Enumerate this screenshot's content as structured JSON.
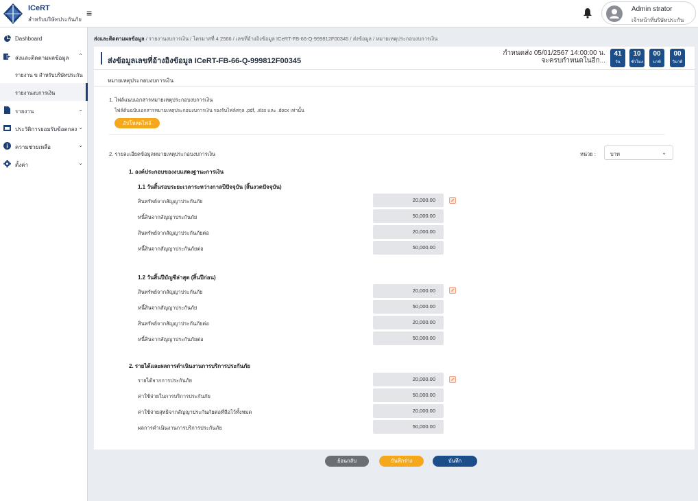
{
  "app": {
    "name": "ICeRT",
    "subtitle": "สำหรับบริษัทประกันภัย"
  },
  "user": {
    "name": "Admin strator",
    "role": "เจ้าหน้าที่บริษัทประกัน"
  },
  "sidebar": {
    "items": [
      {
        "label": "Dashboard",
        "icon": "pie-chart-icon"
      },
      {
        "label": "ส่งและติดตามผลข้อมูล",
        "icon": "send-icon"
      },
      {
        "label": "รายงาน ข สำหรับบริษัทประกัน"
      },
      {
        "label": "รายงานงบการเงิน"
      },
      {
        "label": "รายงาน",
        "icon": "file-icon"
      },
      {
        "label": "ประวัติการยอมรับข้อตกลง",
        "icon": "window-icon"
      },
      {
        "label": "ความช่วยเหลือ",
        "icon": "info-icon"
      },
      {
        "label": "ตั้งค่า",
        "icon": "gear-icon"
      }
    ]
  },
  "breadcrumb": {
    "root": "ส่งและติดตามผลข้อมูล",
    "rest": " / รายงานงบการเงิน / ไตรมาสที่ 4  2566 / เลขที่อ้างอิงข้อมูล ICeRT-FB-66-Q-999812F00345 / ส่งข้อมูล / หมายเหตุประกอบงบการเงิน"
  },
  "header": {
    "title": "ส่งข้อมูลเลขที่อ้างอิงข้อมูล ICeRT-FB-66-Q-999812F00345",
    "deadline_line1": "กำหนดส่ง 05/01/2567 14:00:00 น.",
    "deadline_line2": "จะครบกำหนดในอีก...",
    "countdown": [
      {
        "value": "41",
        "unit": "วัน"
      },
      {
        "value": "10",
        "unit": "ชั่วโมง"
      },
      {
        "value": "00",
        "unit": "นาที"
      },
      {
        "value": "00",
        "unit": "วินาที"
      }
    ]
  },
  "section_title": "หมายเหตุประกอบงบการเงิน",
  "attachment": {
    "heading": "1. ไฟล์แนบเอกสารหมายเหตุประกอบงบการเงิน",
    "note": "ไฟล์ต้นฉบับเอกสารหมายเหตุประกอบงบการเงิน รองรับไฟล์สกุล .pdf, .xlsx และ .docx  เท่านั้น",
    "upload_label": "อัปโหลดไฟล์"
  },
  "details": {
    "heading": "2. รายละเอียดข้อมูลหมายเหตุประกอบงบการเงิน",
    "unit_label": "หน่วย :",
    "unit_value": "บาท"
  },
  "groups": [
    {
      "title": "1.  องค์ประกอบของงบแสดงฐานะการเงิน",
      "subgroups": [
        {
          "title": "1.1 วันสิ้นรอบระยะเวลาระหว่างกาลปีปัจจุบัน (สิ้นงวดปัจจุบัน)",
          "rows": [
            {
              "label": "สินทรัพย์จากสัญญาประกันภัย",
              "value": "20,000.00"
            },
            {
              "label": "หนี้สินจากสัญญาประกันภัย",
              "value": "50,000.00"
            },
            {
              "label": "สินทรัพย์จากสัญญาประกันภัยต่อ",
              "value": "20,000.00"
            },
            {
              "label": "หนี้สินจากสัญญาประกันภัยต่อ",
              "value": "50,000.00"
            }
          ]
        },
        {
          "title": "1.2 วันสิ้นปีบัญชีล่าสุด (สิ้นปีก่อน)",
          "rows": [
            {
              "label": "สินทรัพย์จากสัญญาประกันภัย",
              "value": "20,000.00"
            },
            {
              "label": "หนี้สินจากสัญญาประกันภัย",
              "value": "50,000.00"
            },
            {
              "label": "สินทรัพย์จากสัญญาประกันภัยต่อ",
              "value": "20,000.00"
            },
            {
              "label": "หนี้สินจากสัญญาประกันภัยต่อ",
              "value": "50,000.00"
            }
          ]
        }
      ]
    },
    {
      "title": "2.  รายได้และผลการดำเนินงานการบริการประกันภัย",
      "rows": [
        {
          "label": "รายได้จากการประกันภัย",
          "value": "20,000.00"
        },
        {
          "label": "ค่าใช้จ่ายในการบริการประกันภัย",
          "value": "50,000.00"
        },
        {
          "label": "ค่าใช้จ่ายสุทธิจากสัญญาประกันภัยต่อที่ถือไว้ทั้งหมด",
          "value": "20,000.00"
        },
        {
          "label": "ผลการดำเนินงานการบริการประกันภัย",
          "value": "50,000.00"
        }
      ]
    }
  ],
  "actions": {
    "back": "ย้อนกลับ",
    "draft": "บันทึกร่าง",
    "save": "บันทึก"
  },
  "colors": {
    "brand": "#1c3f7a",
    "accent": "#f5a81c",
    "primary_button": "#1c4f8a",
    "secondary_button": "#6b6e73"
  }
}
